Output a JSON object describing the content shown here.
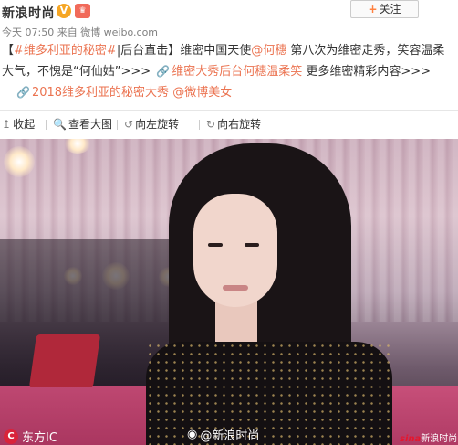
{
  "header": {
    "account_name": "新浪时尚",
    "verified_glyph": "V",
    "gift_glyph": "♛",
    "meta": "今天 07:50 来自 微博 weibo.com",
    "follow_plus": "+",
    "follow_label": "关注"
  },
  "post": {
    "hashtag_open": "【",
    "hashtag_link": "#维多利亚的秘密#",
    "hashtag_rest": "|后台直击】",
    "intro_plain": "维密中国天使",
    "mention_1": "@何穗",
    "after_mention": " 第八次为维密走秀，笑容温柔大气，不愧是“何仙姑”>>> ",
    "link_1": "维密大秀后台何穗温柔笑",
    "after_link_1": " 更多维密精彩内容>>>",
    "link_2": "2018维多利亚的秘密大秀",
    "mention_2": "@微博美女"
  },
  "toolbar": {
    "collapse_label": "收起",
    "view_large_label": "查看大图",
    "rotate_left_label": "向左旋转",
    "rotate_right_label": "向右旋转"
  },
  "photo": {
    "credit_logo": "C",
    "credit_text": "东方IC",
    "watermark_text": "@新浪时尚",
    "sina_mark_s": "sina",
    "sina_mark_text": "新浪时尚"
  },
  "icons": {
    "collapse": "collapse-icon",
    "view_large": "search-icon",
    "rotate_left": "rotate-left-icon",
    "rotate_right": "rotate-right-icon",
    "link": "link-icon"
  },
  "colors": {
    "link": "#eb7350",
    "verified": "#f6a623",
    "follow_plus": "#ff8140"
  }
}
